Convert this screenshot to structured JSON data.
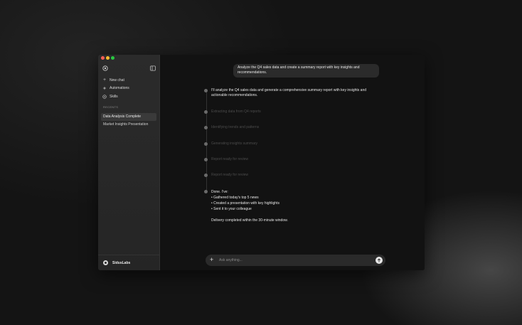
{
  "sidebar": {
    "toggle_icon": "sidebar-toggle-icon",
    "logo_icon": "app-logo-icon",
    "nav": [
      {
        "label": "New chat",
        "icon": "plus-icon"
      },
      {
        "label": "Automations",
        "icon": "sparkle-icon"
      },
      {
        "label": "Skills",
        "icon": "skills-icon"
      }
    ],
    "recents_label": "RECENTS",
    "recents": [
      {
        "label": "Data Analysis Complete",
        "active": true
      },
      {
        "label": "Market Insights Presentation",
        "active": false
      }
    ],
    "user": {
      "name": "SidusLabs"
    }
  },
  "chat": {
    "user_message": "Analyze the Q4 sales data and create a summary report with key insights and recommendations.",
    "assistant_intro": "I'll analyze the Q4 sales data and generate a comprehensive summary report with key insights and actionable recommendations.",
    "steps": [
      "Extracting data from Q4 reports",
      "Identifying trends and patterns",
      "Generating insights summary",
      "Report ready for review",
      "Report ready for review"
    ],
    "done": {
      "heading": "Done. I've:",
      "items": [
        "• Gathered today's top 5 news",
        "• Created a presentation with key highlights",
        "• Sent it to your colleague"
      ],
      "footer": "Delivery completed within the 30-minute window."
    }
  },
  "input": {
    "placeholder": "Ask anything..."
  }
}
